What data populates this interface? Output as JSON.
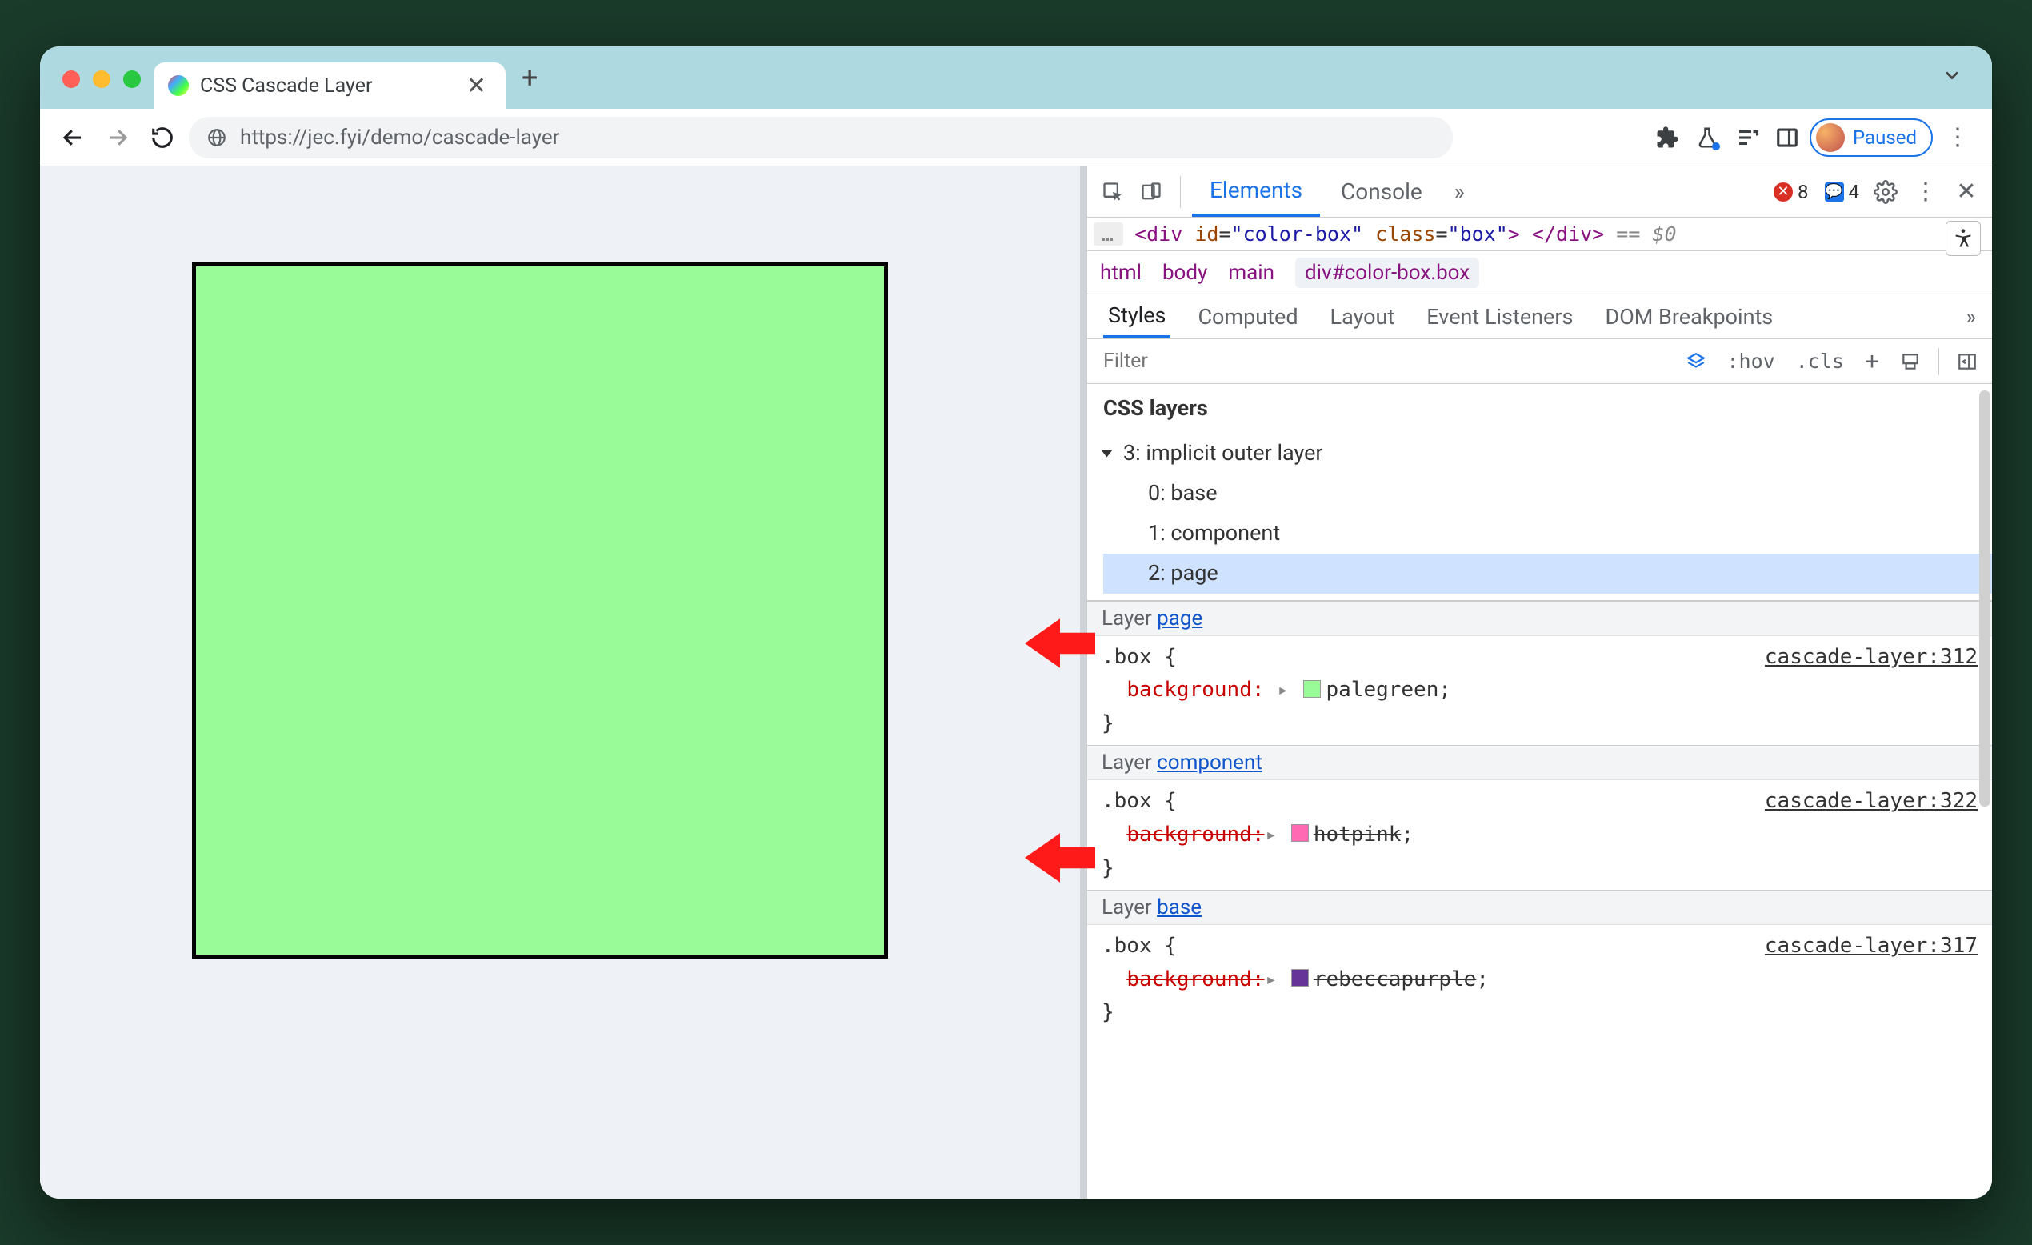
{
  "tab": {
    "title": "CSS Cascade Layer"
  },
  "toolbar": {
    "url": "https://jec.fyi/demo/cascade-layer",
    "paused_label": "Paused"
  },
  "devtools": {
    "tabs": {
      "elements": "Elements",
      "console": "Console"
    },
    "counts": {
      "errors": 8,
      "messages": 4
    },
    "dom_preview": {
      "tag": "div",
      "id": "color-box",
      "class": "box",
      "suffix": "== $0"
    },
    "breadcrumb": [
      "html",
      "body",
      "main",
      "div#color-box.box"
    ],
    "subtabs": {
      "styles": "Styles",
      "computed": "Computed",
      "layout": "Layout",
      "event_listeners": "Event Listeners",
      "dom_breakpoints": "DOM Breakpoints"
    },
    "filter": {
      "placeholder": "Filter",
      "hov": ":hov",
      "cls": ".cls",
      "plus": "+"
    },
    "css_layers": {
      "title": "CSS layers",
      "root": "3: implicit outer layer",
      "items": [
        "0: base",
        "1: component",
        "2: page"
      ],
      "selected_index": 2
    },
    "rules": [
      {
        "layer_label": "Layer ",
        "layer_link": "page",
        "source": "cascade-layer:312",
        "selector": ".box",
        "prop": "background",
        "value": "palegreen",
        "swatch": "sw-palegreen",
        "struck": false
      },
      {
        "layer_label": "Layer ",
        "layer_link": "component",
        "source": "cascade-layer:322",
        "selector": ".box",
        "prop": "background",
        "value": "hotpink",
        "swatch": "sw-hotpink",
        "struck": true
      },
      {
        "layer_label": "Layer ",
        "layer_link": "base",
        "source": "cascade-layer:317",
        "selector": ".box",
        "prop": "background",
        "value": "rebeccapurple",
        "swatch": "sw-rebecca",
        "struck": true
      }
    ]
  }
}
